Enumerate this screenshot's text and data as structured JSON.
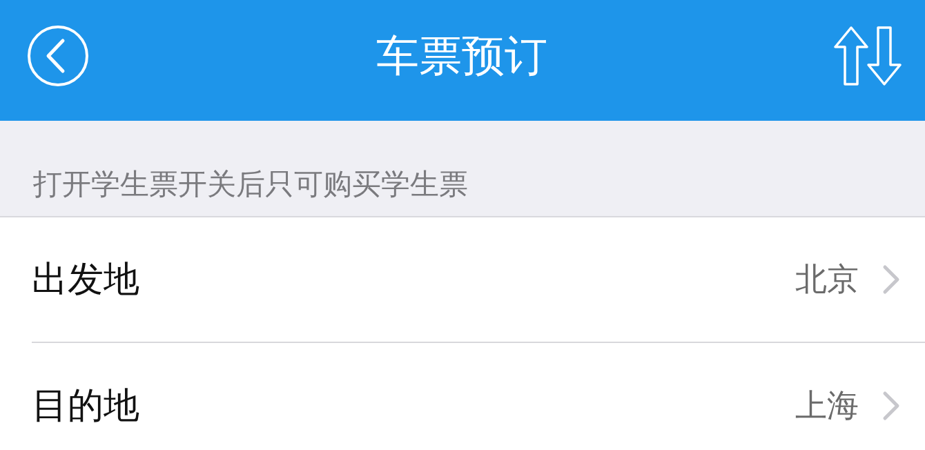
{
  "nav_bar": {
    "title": "车票预订"
  },
  "section_header": {
    "text": "打开学生票开关后只可购买学生票"
  },
  "rows": [
    {
      "label": "出发地",
      "value": "北京"
    },
    {
      "label": "目的地",
      "value": "上海"
    }
  ]
}
